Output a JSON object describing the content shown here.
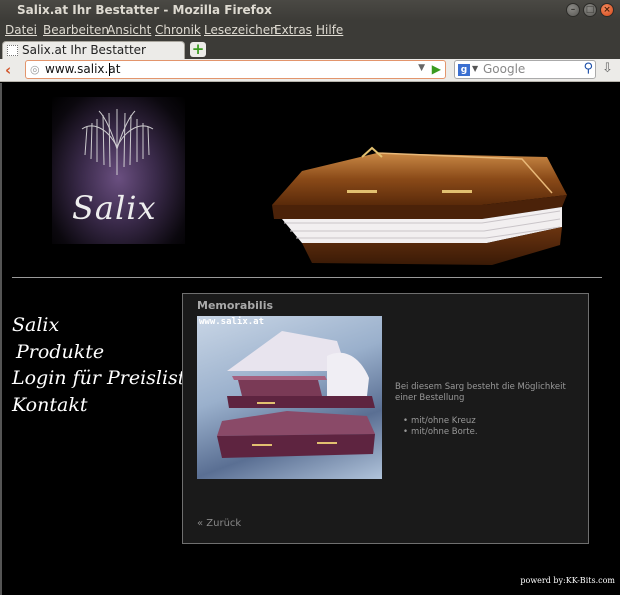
{
  "window": {
    "title": "Salix.at Ihr Bestatter - Mozilla Firefox"
  },
  "menu": [
    "Datei",
    "Bearbeiten",
    "Ansicht",
    "Chronik",
    "Lesezeichen",
    "Extras",
    "Hilfe"
  ],
  "tab": {
    "label": "Salix.at Ihr Bestatter",
    "new_tab": "+"
  },
  "urlbar": {
    "value": "www.salix.at"
  },
  "search": {
    "engine_letter": "g",
    "placeholder": "Google"
  },
  "site": {
    "logo_text": "Salix",
    "nav": [
      "Salix",
      "Produkte",
      "Login für Preisliste",
      "Kontakt"
    ],
    "box_title": "Memorabilis",
    "image_watermark": "www.salix.at",
    "description": "Bei diesem Sarg besteht die Möglichkeit einer Bestellung",
    "features": [
      "mit/ohne Kreuz",
      "mit/ohne Borte."
    ],
    "back_link": "« Zurück",
    "footer": "powerd by:KK-Bits.com"
  },
  "colors": {
    "accent_orange": "#d3481a",
    "chrome_dark": "#3c3b37",
    "page_bg": "#000000",
    "coffin_wood": "#7a3e14"
  }
}
